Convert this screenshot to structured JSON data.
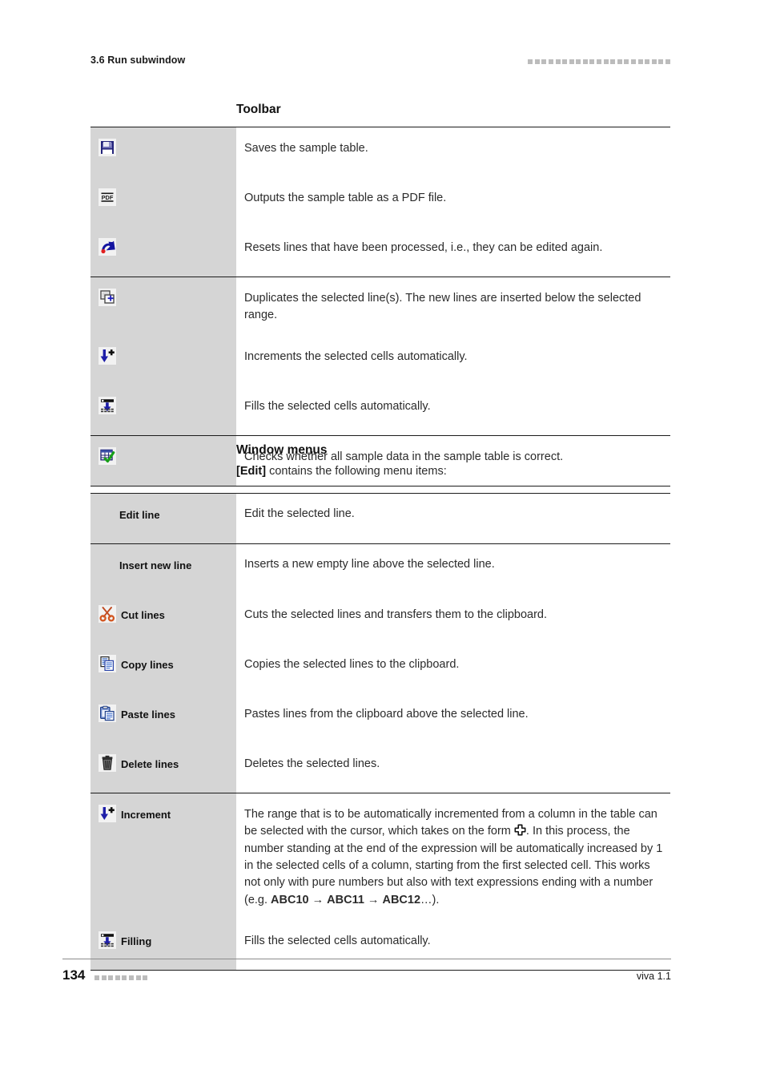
{
  "header": {
    "running_title": "3.6 Run subwindow",
    "decoration_squares": 21,
    "decoration_color": "#bcbcbc"
  },
  "toolbar_section": {
    "heading": "Toolbar",
    "groups": [
      {
        "rows": [
          {
            "icon": "save-floppy-icon",
            "label": "",
            "description": "Saves the sample table."
          },
          {
            "icon": "pdf-export-icon",
            "label": "",
            "description": "Outputs the sample table as a PDF file."
          },
          {
            "icon": "reset-undo-arrow-icon",
            "label": "",
            "description": "Resets lines that have been processed, i.e., they can be edited again."
          }
        ]
      },
      {
        "rows": [
          {
            "icon": "duplicate-lines-icon",
            "label": "",
            "description": "Duplicates the selected line(s). The new lines are inserted below the selected range."
          },
          {
            "icon": "increment-down-plus-icon",
            "label": "",
            "description": "Increments the selected cells automatically."
          },
          {
            "icon": "fill-down-icon",
            "label": "",
            "description": "Fills the selected cells automatically."
          }
        ]
      },
      {
        "rows": [
          {
            "icon": "check-table-icon",
            "label": "",
            "description": "Checks whether all sample data in the sample table is correct."
          }
        ]
      }
    ]
  },
  "window_menus_section": {
    "heading": "Window menus",
    "intro_bold": "[Edit]",
    "intro_rest": " contains the following menu items:",
    "groups": [
      {
        "rows": [
          {
            "icon": "",
            "label": "Edit line",
            "description": "Edit the selected line."
          }
        ]
      },
      {
        "rows": [
          {
            "icon": "",
            "label": "Insert new line",
            "description": "Inserts a new empty line above the selected line."
          },
          {
            "icon": "cut-scissors-icon",
            "label": "Cut lines",
            "description": "Cuts the selected lines and transfers them to the clipboard."
          },
          {
            "icon": "copy-pages-icon",
            "label": "Copy lines",
            "description": "Copies the selected lines to the clipboard."
          },
          {
            "icon": "paste-clipboard-icon",
            "label": "Paste lines",
            "description": "Pastes lines from the clipboard above the selected line."
          },
          {
            "icon": "delete-trash-icon",
            "label": "Delete lines",
            "description": "Deletes the selected lines."
          }
        ]
      },
      {
        "rows": [
          {
            "icon": "increment-down-plus-icon",
            "label": "Increment",
            "description_parts": {
              "p1": "The range that is to be automatically incremented from a column in the table can be selected with the cursor, which takes on the form ",
              "cursor_icon": "cross-cursor-icon",
              "p2": ". In this process, the number standing at the end of the expression will be automatically increased by 1 in the selected cells of a column, starting from the first selected cell. This works not only with pure numbers but also with text expressions ending with a number (e.g. ",
              "example_1": "ABC10",
              "arrow_1": " → ",
              "example_2": "ABC11",
              "arrow_2": " → ",
              "example_3": "ABC12",
              "p3": "…)."
            }
          },
          {
            "icon": "fill-down-icon",
            "label": "Filling",
            "description": "Fills the selected cells automatically."
          }
        ]
      }
    ]
  },
  "footer": {
    "page_number": "134",
    "decoration_squares": 8,
    "decoration_color": "#bcbcbc",
    "document_version": "viva 1.1"
  }
}
